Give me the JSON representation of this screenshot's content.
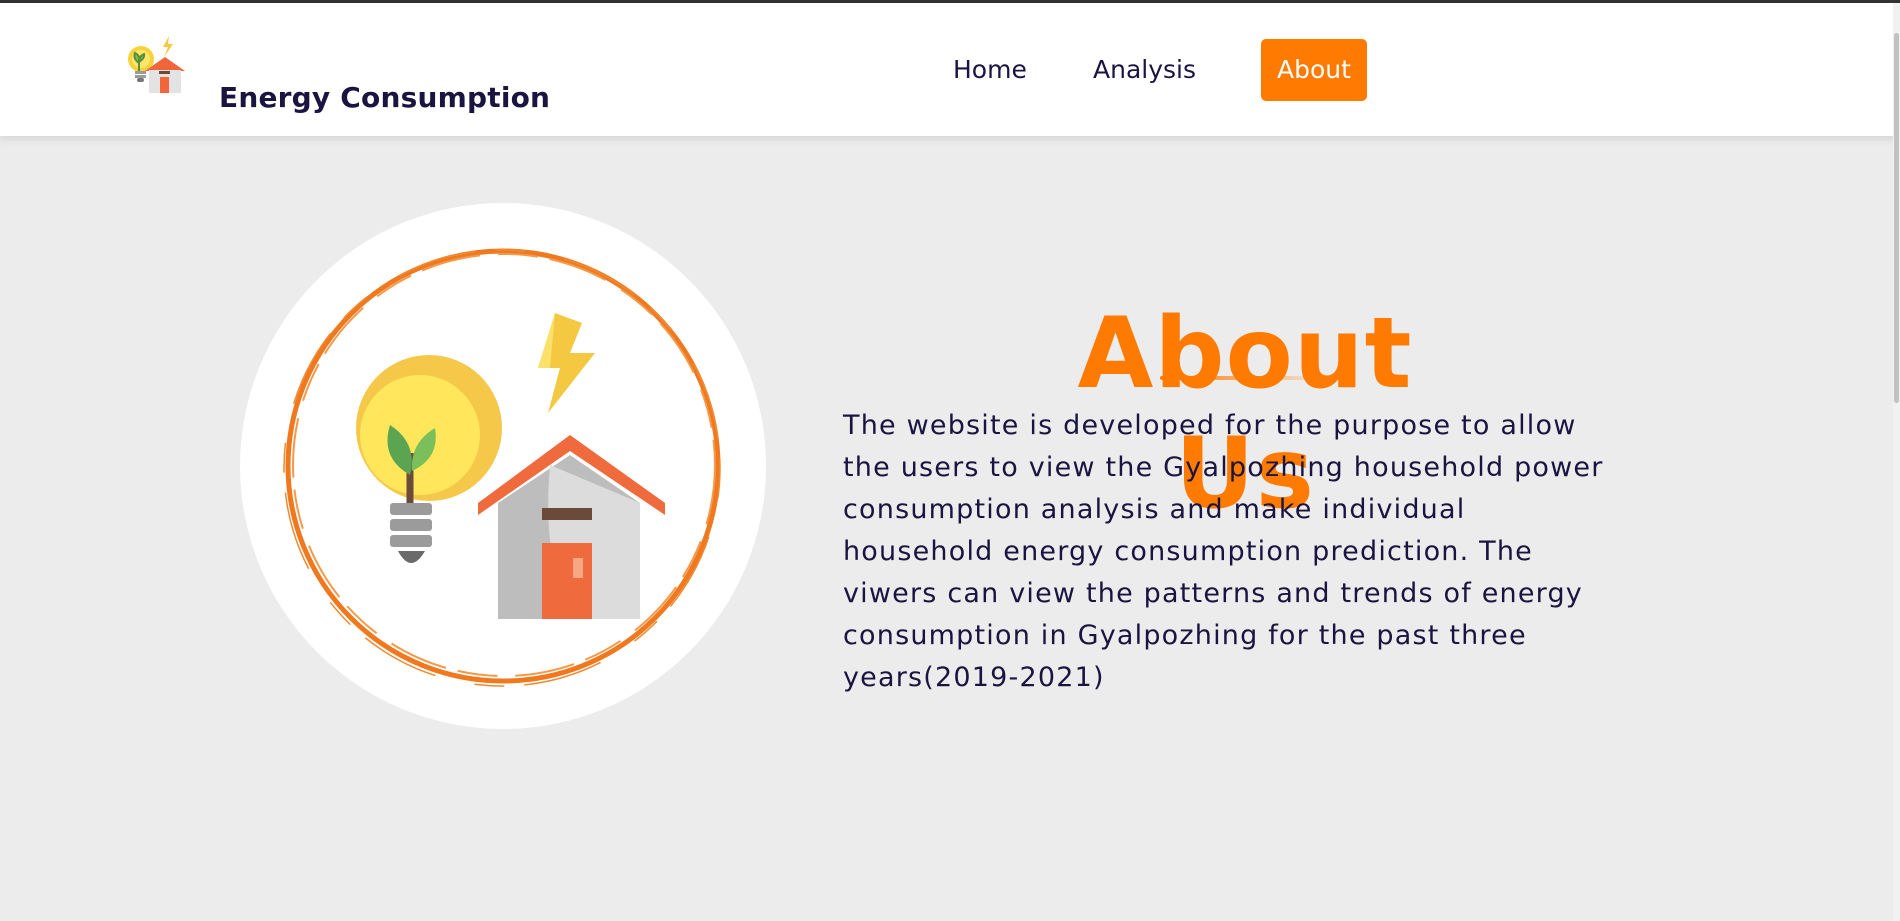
{
  "header": {
    "logo_icon": "bulb-house-logo-icon",
    "brand_title": "Energy Consumption"
  },
  "nav": {
    "items": [
      {
        "label": "Home",
        "active": false
      },
      {
        "label": "Analysis",
        "active": false
      },
      {
        "label": "About",
        "active": true
      }
    ]
  },
  "about": {
    "heading": "About Us",
    "paragraph": "The website is developed for the purpose to allow the users to view the Gyalpozhing household power consumption analysis and make individual household energy consumption prediction. The viwers can view the patterns and trends of energy consumption in Gyalpozhing for the past three years(2019-2021)",
    "illustration": "bulb-house-energy-illustration"
  },
  "colors": {
    "accent": "#ff7a00",
    "text_dark": "#1a1540",
    "page_bg": "#ececec",
    "header_bg": "#ffffff"
  }
}
